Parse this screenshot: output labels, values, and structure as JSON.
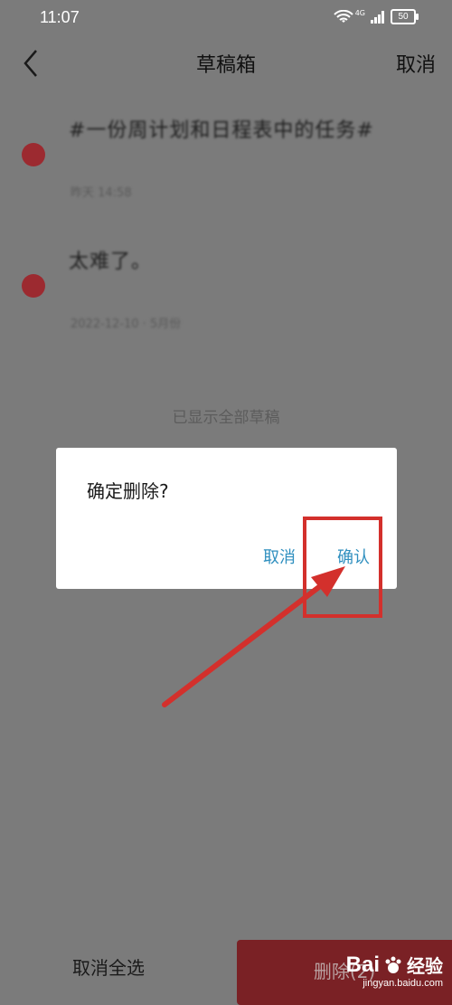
{
  "status": {
    "time": "11:07",
    "signal_label": "4G",
    "battery": "50"
  },
  "nav": {
    "title": "草稿箱",
    "cancel": "取消"
  },
  "drafts": [
    {
      "title": "#一份周计划和日程表中的任务#",
      "meta": "昨天 14:58"
    },
    {
      "title": "太难了。",
      "meta": "2022-12-10 · 5月份"
    }
  ],
  "list_footer": "已显示全部草稿",
  "dialog": {
    "title": "确定删除?",
    "cancel": "取消",
    "confirm": "确认"
  },
  "bottom": {
    "cancel_all": "取消全选",
    "delete": "删除(2)"
  },
  "watermark": {
    "brand": "Bai",
    "brand_suffix": "经验",
    "url": "jingyan.baidu.com"
  },
  "colors": {
    "accent": "#2f8fbf",
    "annotation": "#d3302c",
    "overlay": "#7b7b7b"
  }
}
